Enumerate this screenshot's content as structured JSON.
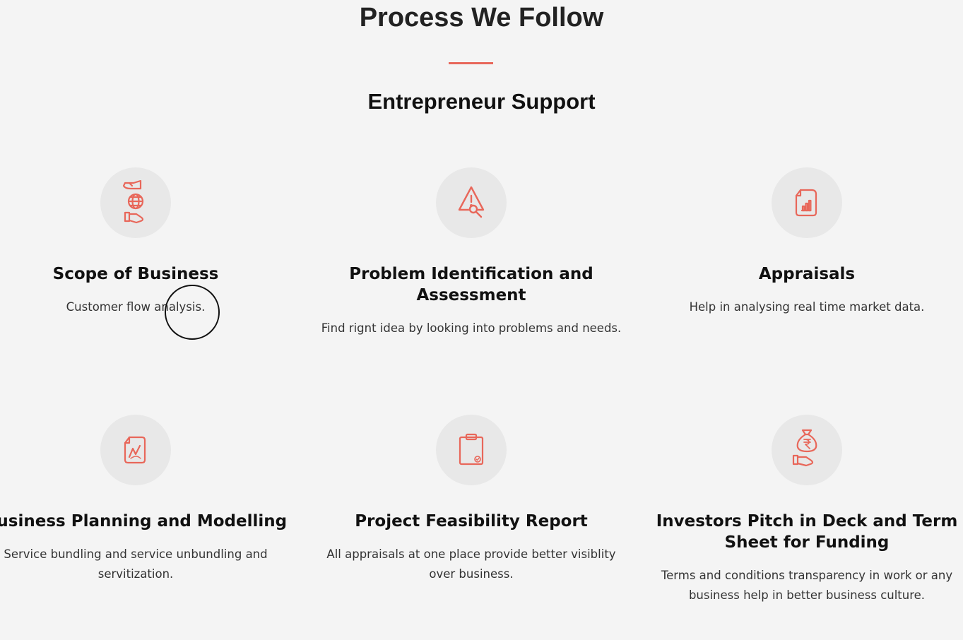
{
  "header": {
    "title": "Process We Follow",
    "subtitle": "Entrepreneur Support"
  },
  "colors": {
    "accent": "#e8675a",
    "icon_bg": "#e8e8e8",
    "page_bg": "#f4f4f4"
  },
  "cards": [
    {
      "icon": "hands-globe-icon",
      "title": "Scope of Business",
      "description": "Customer flow analysis."
    },
    {
      "icon": "warning-magnifier-icon",
      "title": "Problem Identification and Assessment",
      "description": "Find rignt idea by looking into problems and needs."
    },
    {
      "icon": "document-chart-icon",
      "title": "Appraisals",
      "description": "Help in analysing real time market data."
    },
    {
      "icon": "document-graph-icon",
      "title": "Business Planning and Modelling",
      "description": "Service bundling and service unbundling and servitization."
    },
    {
      "icon": "clipboard-check-icon",
      "title": "Project Feasibility Report",
      "description": "All appraisals at one place provide better visiblity over business."
    },
    {
      "icon": "money-bag-hand-icon",
      "title": "Investors Pitch in Deck and Term Sheet for Funding",
      "description": "Terms and conditions transparency in work or any business help in better business culture."
    }
  ]
}
